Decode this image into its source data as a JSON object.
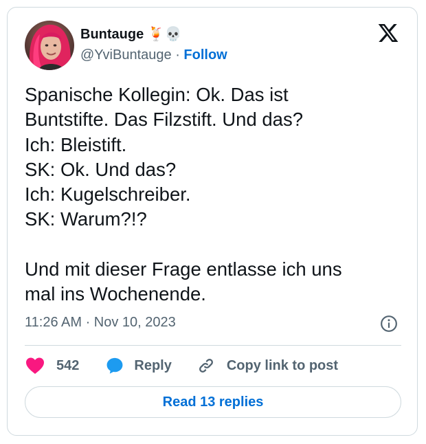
{
  "author": {
    "display_name": "Buntauge 🍹💀",
    "handle": "@YviBuntauge",
    "separator": "·",
    "follow_label": "Follow"
  },
  "tweet": {
    "text": "Spanische Kollegin: Ok. Das ist\nBuntstifte. Das Filzstift. Und das?\nIch: Bleistift.\nSK: Ok. Und das?\nIch: Kugelschreiber.\nSK: Warum?!?\n\nUnd mit dieser Frage entlasse ich uns\nmal ins Wochenende.",
    "timestamp": "11:26 AM · Nov 10, 2023"
  },
  "actions": {
    "like_count": "542",
    "reply_label": "Reply",
    "copy_link_label": "Copy link to post"
  },
  "read_replies_label": "Read 13 replies",
  "icons": {
    "platform_logo": "x-logo-icon",
    "info": "info-icon",
    "like": "heart-icon",
    "reply": "speech-bubble-icon",
    "copy_link": "link-icon"
  },
  "colors": {
    "like": "#f91880",
    "accent": "#006fd6",
    "reply_bubble": "#1d9bf0",
    "muted_text": "#536471"
  }
}
